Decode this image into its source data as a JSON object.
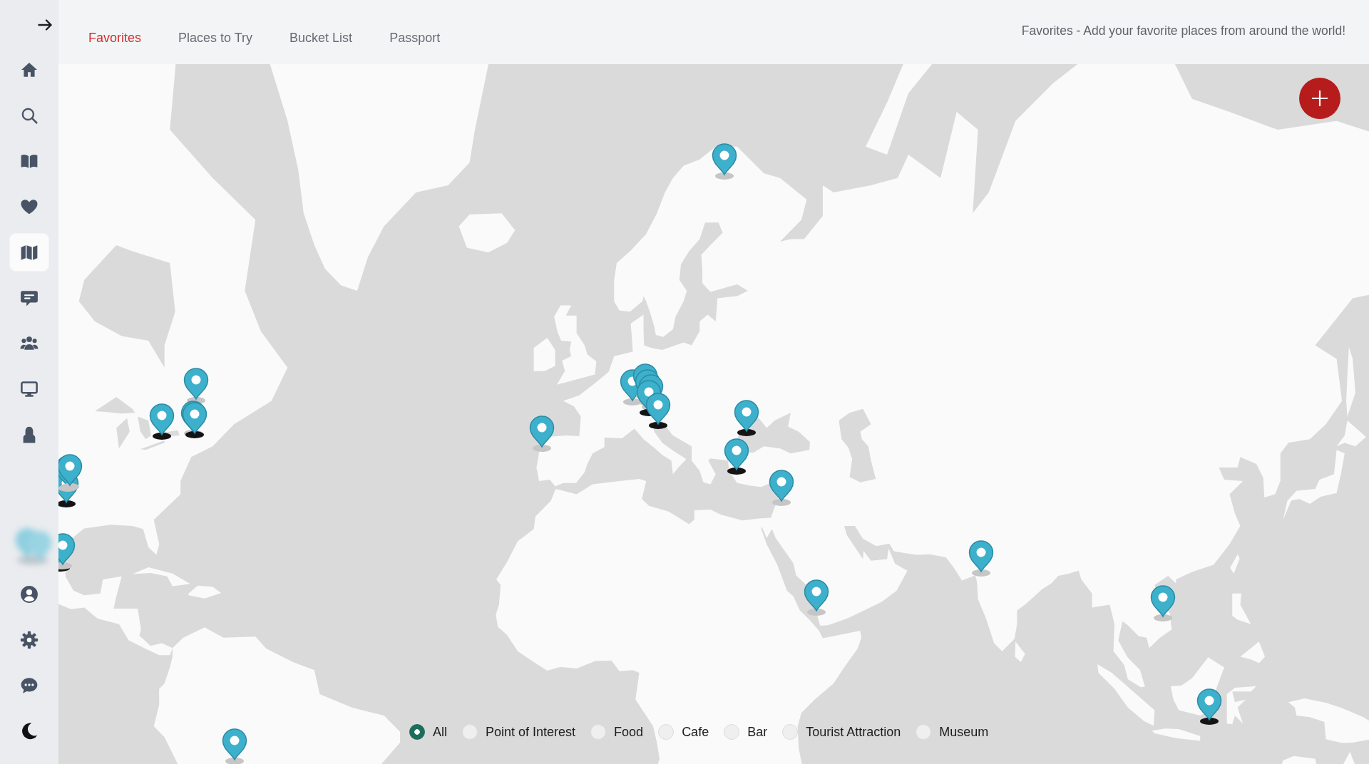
{
  "sidebar": {
    "items": [
      {
        "selected": false
      },
      {
        "selected": false
      },
      {
        "selected": false
      },
      {
        "selected": false
      },
      {
        "selected": true
      },
      {
        "selected": false
      },
      {
        "selected": false
      },
      {
        "selected": false
      },
      {
        "selected": false
      }
    ],
    "bottom_items": [
      {
        "selected": false
      },
      {
        "selected": false
      },
      {
        "selected": false
      },
      {
        "selected": false
      }
    ]
  },
  "tabs": [
    {
      "label": "Favorites",
      "selected": true
    },
    {
      "label": "Places to Try",
      "selected": false
    },
    {
      "label": "Bucket List",
      "selected": false
    },
    {
      "label": "Passport",
      "selected": false
    }
  ],
  "header": {
    "description": "Favorites - Add your favorite places from around the world!"
  },
  "filters": [
    {
      "label": "All",
      "selected": true
    },
    {
      "label": "Point of Interest",
      "selected": false
    },
    {
      "label": "Food",
      "selected": false
    },
    {
      "label": "Cafe",
      "selected": false
    },
    {
      "label": "Bar",
      "selected": false
    },
    {
      "label": "Tourist Attraction",
      "selected": false
    },
    {
      "label": "Museum",
      "selected": false
    }
  ]
}
